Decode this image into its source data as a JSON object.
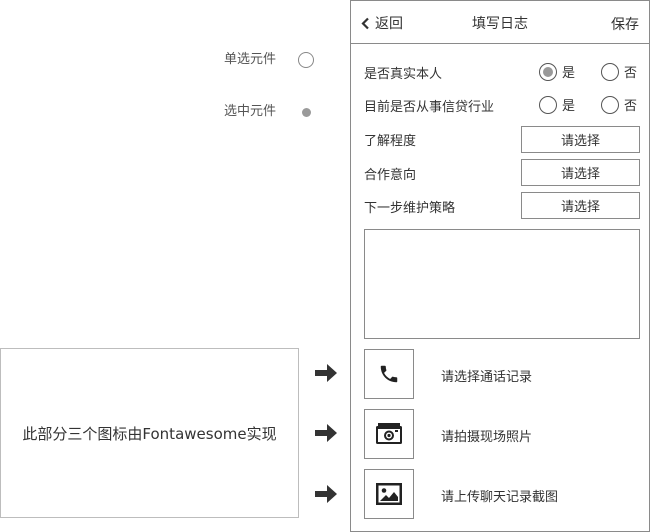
{
  "legend": {
    "unselected_label": "单选元件",
    "selected_label": "选中元件"
  },
  "annotation": {
    "text": "此部分三个图标由Fontawesome实现"
  },
  "header": {
    "back_label": "返回",
    "title": "填写日志",
    "save_label": "保存"
  },
  "form": {
    "q1": {
      "label": "是否真实本人",
      "yes": "是",
      "no": "否",
      "selected": "yes"
    },
    "q2": {
      "label": "目前是否从事信贷行业",
      "yes": "是",
      "no": "否",
      "selected": "none"
    },
    "understanding": {
      "label": "了解程度",
      "button": "请选择"
    },
    "intent": {
      "label": "合作意向",
      "button": "请选择"
    },
    "next_step": {
      "label": "下一步维护策略",
      "button": "请选择"
    },
    "notes": {
      "value": ""
    }
  },
  "actions": [
    {
      "icon": "phone-icon",
      "label": "请选择通话记录"
    },
    {
      "icon": "camera-icon",
      "label": "请拍摄现场照片"
    },
    {
      "icon": "image-icon",
      "label": "请上传聊天记录截图"
    }
  ],
  "colors": {
    "border": "#8a8a8a",
    "text": "#333333",
    "selected_dot": "#999999"
  }
}
